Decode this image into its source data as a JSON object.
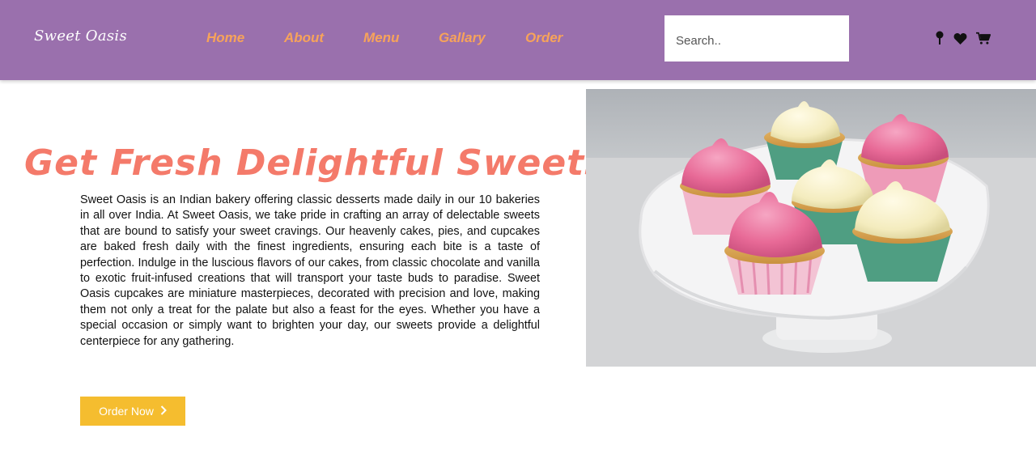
{
  "header": {
    "logo": "Sweet Oasis",
    "nav": [
      "Home",
      "About",
      "Menu",
      "Gallary",
      "Order"
    ],
    "search": {
      "placeholder": "Search..",
      "value": ""
    },
    "icons": [
      "map-pin-icon",
      "heart-icon",
      "cart-icon"
    ]
  },
  "hero": {
    "title": "Get Fresh Delightful Sweets",
    "description": "Sweet Oasis is an Indian bakery offering classic desserts made daily in our 10 bakeries in all over India. At Sweet Oasis, we take pride in crafting an array of delectable sweets that are bound to satisfy your sweet cravings. Our heavenly cakes, pies, and cupcakes are baked fresh daily with the finest ingredients, ensuring each bite is a taste of perfection. Indulge in the luscious flavors of our cakes, from classic chocolate and vanilla to exotic fruit-infused creations that will transport your taste buds to paradise. Sweet Oasis cupcakes are miniature masterpieces, decorated with precision and love, making them not only a treat for the palate but also a feast for the eyes. Whether you have a special occasion or simply want to brighten your day, our sweets provide a delightful centerpiece for any gathering.",
    "cta_label": "Order Now"
  },
  "colors": {
    "header_bg": "#9a70ad",
    "nav_link": "#f7a35a",
    "title": "#f47a6a",
    "button": "#f5bd2f"
  }
}
